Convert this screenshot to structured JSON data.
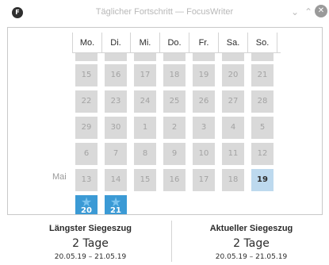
{
  "window": {
    "title": "Täglicher Fortschritt — FocusWriter",
    "minimize_icon": "chevron-down-icon",
    "maximize_icon": "chevron-up-icon",
    "close_icon": "close-icon"
  },
  "calendar": {
    "weekdays": [
      "Mo.",
      "Di.",
      "Mi.",
      "Do.",
      "Fr.",
      "Sa.",
      "So."
    ],
    "month_label": "Mai",
    "rows": [
      {
        "days": [
          "15",
          "16",
          "17",
          "18",
          "19",
          "20",
          "21"
        ]
      },
      {
        "days": [
          "22",
          "23",
          "24",
          "25",
          "26",
          "27",
          "28"
        ]
      },
      {
        "days": [
          "29",
          "30",
          "1",
          "2",
          "3",
          "4",
          "5"
        ]
      },
      {
        "days": [
          "6",
          "7",
          "8",
          "9",
          "10",
          "11",
          "12"
        ]
      },
      {
        "days": [
          "13",
          "14",
          "15",
          "16",
          "17",
          "18",
          "19"
        ]
      },
      {
        "days": [
          "20",
          "21"
        ]
      }
    ],
    "today": "19",
    "streak_days": [
      "20",
      "21"
    ],
    "colors": {
      "cell_bg": "#d9d9d9",
      "cell_text": "#a3a3a3",
      "today_bg": "#bdd9ee",
      "streak_bg": "#3b9ad5"
    }
  },
  "stats": {
    "longest": {
      "title": "Längster Siegeszug",
      "value": "2 Tage",
      "range": "20.05.19 – 21.05.19"
    },
    "current": {
      "title": "Aktueller Siegeszug",
      "value": "2 Tage",
      "range": "20.05.19 – 21.05.19"
    }
  }
}
